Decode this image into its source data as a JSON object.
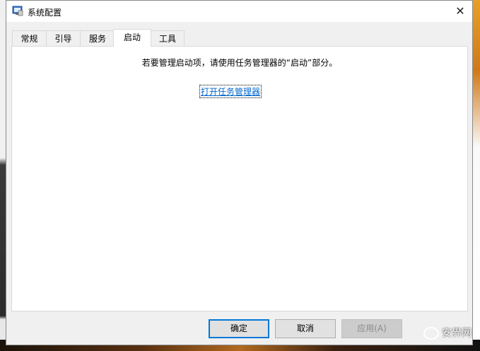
{
  "window": {
    "title": "系统配置",
    "close_glyph": "✕"
  },
  "tabs": [
    {
      "label": "常规"
    },
    {
      "label": "引导"
    },
    {
      "label": "服务"
    },
    {
      "label": "启动",
      "active": true
    },
    {
      "label": "工具"
    }
  ],
  "startup": {
    "message": "若要管理启动项，请使用任务管理器的“启动”部分。",
    "link_text": "打开任务管理器"
  },
  "buttons": {
    "ok": "确定",
    "cancel": "取消",
    "apply": "应用(A)"
  },
  "watermark": {
    "text": "安界网"
  },
  "colors": {
    "accent": "#0078d7",
    "link": "#0066cc"
  }
}
